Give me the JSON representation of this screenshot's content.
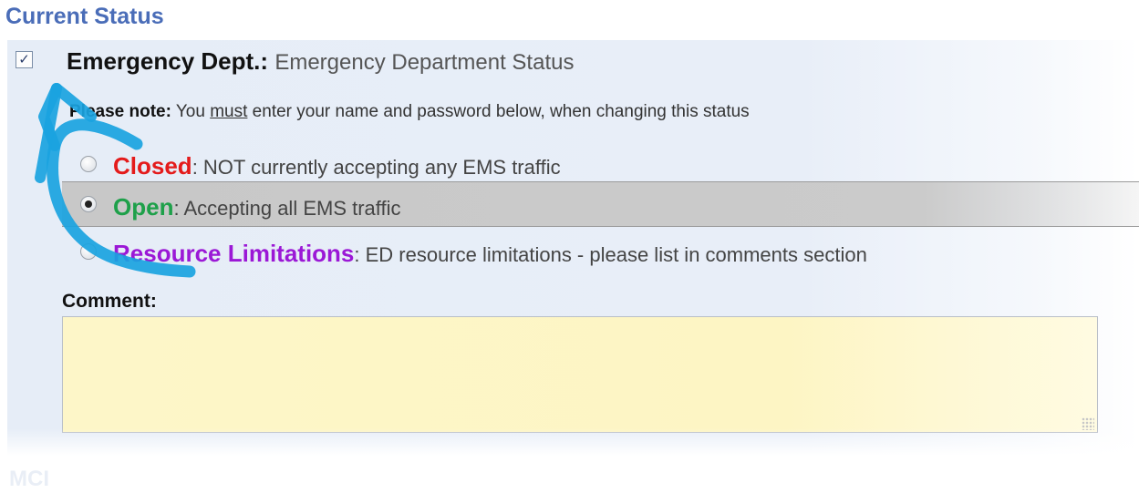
{
  "section": {
    "title": "Current Status",
    "next_title": "MCI"
  },
  "department": {
    "checked": true,
    "name": "Emergency Dept.:",
    "description": "Emergency Department Status"
  },
  "note": {
    "label": "Please note:",
    "text_before": "You ",
    "emphasis": "must",
    "text_after": " enter your name and password below, when changing this status"
  },
  "statuses": [
    {
      "label": "Closed",
      "description": ": NOT currently accepting any EMS traffic",
      "color": "#e41b1b",
      "selected": false
    },
    {
      "label": "Open",
      "description": ": Accepting all EMS traffic",
      "color": "#1ea04a",
      "selected": true
    },
    {
      "label": "Resource Limitations",
      "description": ": ED resource limitations - please list in comments section",
      "color": "#9b18d6",
      "selected": false
    }
  ],
  "comment": {
    "label": "Comment:",
    "value": ""
  },
  "annotation": {
    "type": "hand-drawn-arrow",
    "color": "#1aa3e0",
    "points_to": "department-checkbox"
  }
}
